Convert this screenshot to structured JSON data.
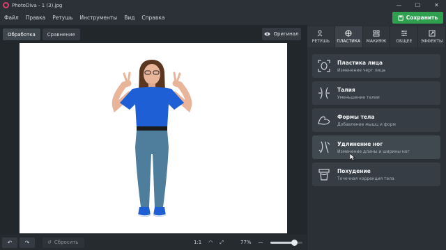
{
  "window": {
    "title": "PhotoDiva - 1 (3).jpg",
    "controls": [
      "—",
      "☐",
      "✕"
    ]
  },
  "menu": [
    "Файл",
    "Правка",
    "Ретушь",
    "Инструменты",
    "Вид",
    "Справка"
  ],
  "save_label": "Сохранить",
  "view_tabs": [
    "Обработка",
    "Сравнение"
  ],
  "original_label": "Оригинал",
  "tool_tabs": [
    {
      "label": "РЕТУШЬ",
      "icon": "retouch-icon"
    },
    {
      "label": "ПЛАСТИКА",
      "icon": "plastic-icon",
      "active": true
    },
    {
      "label": "МАКИЯЖ",
      "icon": "makeup-icon"
    },
    {
      "label": "ОБЩЕЕ",
      "icon": "sliders-icon"
    },
    {
      "label": "ЭФФЕКТЫ",
      "icon": "effects-icon"
    }
  ],
  "cards": [
    {
      "title": "Пластика лица",
      "subtitle": "Изменение черт лица",
      "icon": "face-icon"
    },
    {
      "title": "Талия",
      "subtitle": "Уменьшение талии",
      "icon": "waist-icon"
    },
    {
      "title": "Формы тела",
      "subtitle": "Добавление мышц и форм",
      "icon": "muscle-icon"
    },
    {
      "title": "Удлинение ног",
      "subtitle": "Изменение длины и ширины ног",
      "icon": "legs-icon",
      "hover": true
    },
    {
      "title": "Похудение",
      "subtitle": "Точечная коррекция тела",
      "icon": "slim-icon"
    }
  ],
  "bottom": {
    "reset_label": "Сбросить",
    "ratio_label": "1:1",
    "zoom_value": "77%",
    "zoom_fraction": 0.77
  },
  "colors": {
    "accent_green": "#2ea04f",
    "shirt_blue": "#1f5fd6",
    "jeans": "#4f7d9c"
  }
}
